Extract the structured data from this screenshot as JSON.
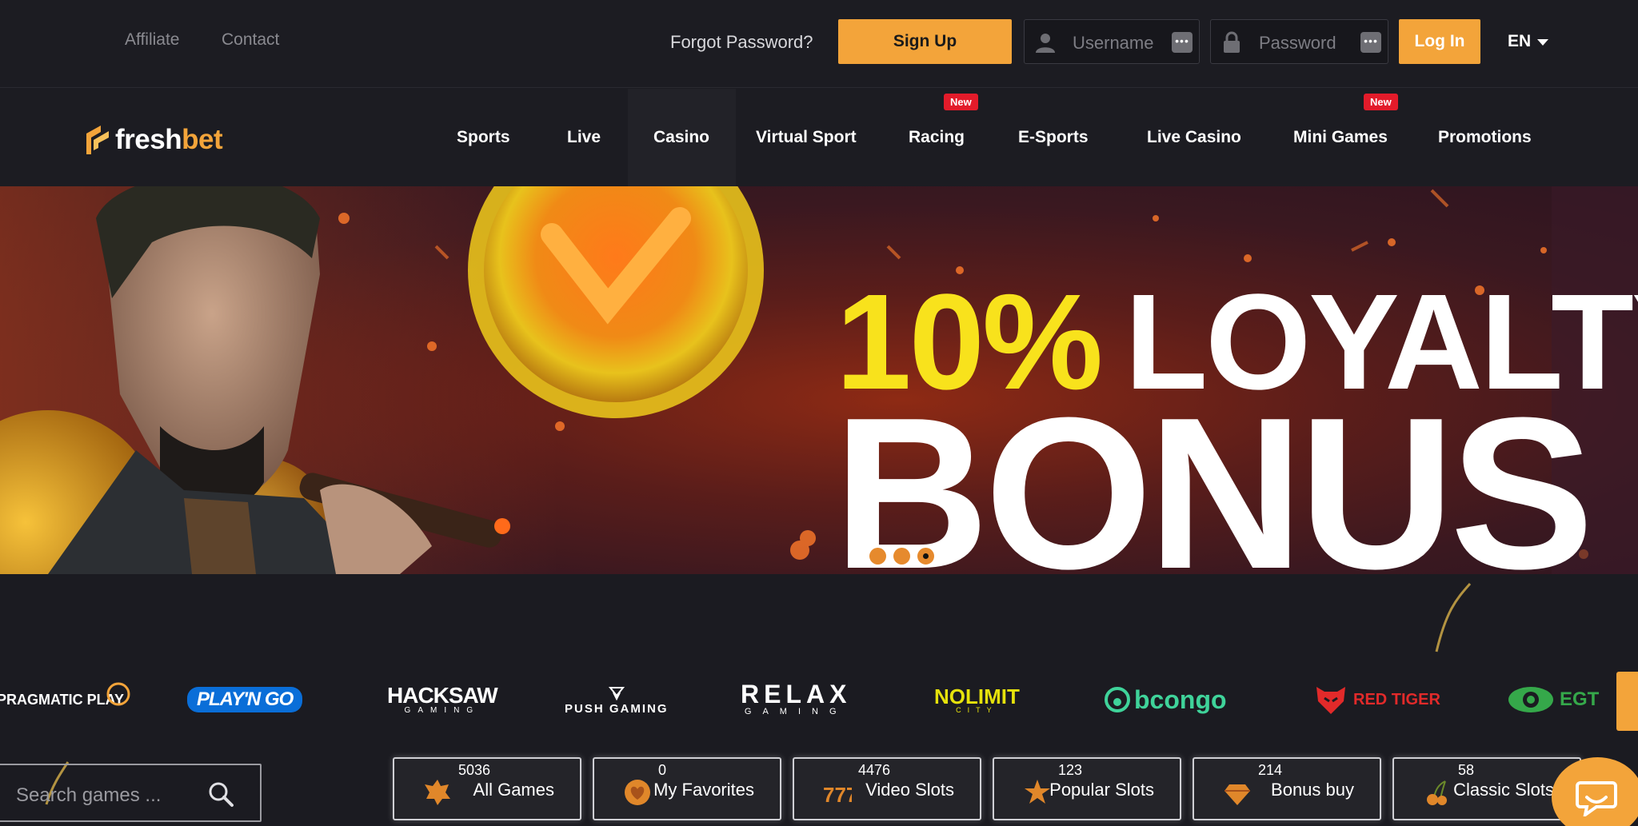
{
  "topbar": {
    "links": [
      "Affiliate",
      "Contact"
    ],
    "forgot": "Forgot Password?",
    "signup": "Sign Up",
    "username_placeholder": "Username",
    "password_placeholder": "Password",
    "login": "Log In",
    "lang": "EN"
  },
  "brand": {
    "part1": "fresh",
    "part2": "bet"
  },
  "nav": {
    "items": [
      "Sports",
      "Live",
      "Casino",
      "Virtual Sport",
      "Racing",
      "E-Sports",
      "Live Casino",
      "Mini Games",
      "Promotions"
    ],
    "active": "Casino",
    "new_badge": "New"
  },
  "banner": {
    "line1_pct": "10%",
    "line1_word": "LOYALTY",
    "line2": "BONUS",
    "slides": 3,
    "active_slide": 3
  },
  "providers": [
    "PRAGMATIC PLAY",
    "PLAY'N GO",
    "HACKSAW",
    "GAMING",
    "PUSH GAMING",
    "RELAX",
    "GAMING",
    "NOLIMIT",
    "CITY",
    "bcongo",
    "RED TIGER",
    "EGT"
  ],
  "search": {
    "placeholder": "Search games ..."
  },
  "categories": [
    {
      "count": "5036",
      "label": "All Games",
      "icon": "all-games-icon"
    },
    {
      "count": "0",
      "label": "My Favorites",
      "icon": "heart-icon"
    },
    {
      "count": "4476",
      "label": "Video Slots",
      "icon": "sevens-icon"
    },
    {
      "count": "123",
      "label": "Popular Slots",
      "icon": "star-icon"
    },
    {
      "count": "214",
      "label": "Bonus buy",
      "icon": "diamond-icon"
    },
    {
      "count": "58",
      "label": "Classic Slots",
      "icon": "cherry-icon"
    }
  ],
  "colors": {
    "accent": "#f3a43a",
    "badge": "#e31b2a",
    "bg": "#1b1b21",
    "yellow": "#f8e21c"
  }
}
